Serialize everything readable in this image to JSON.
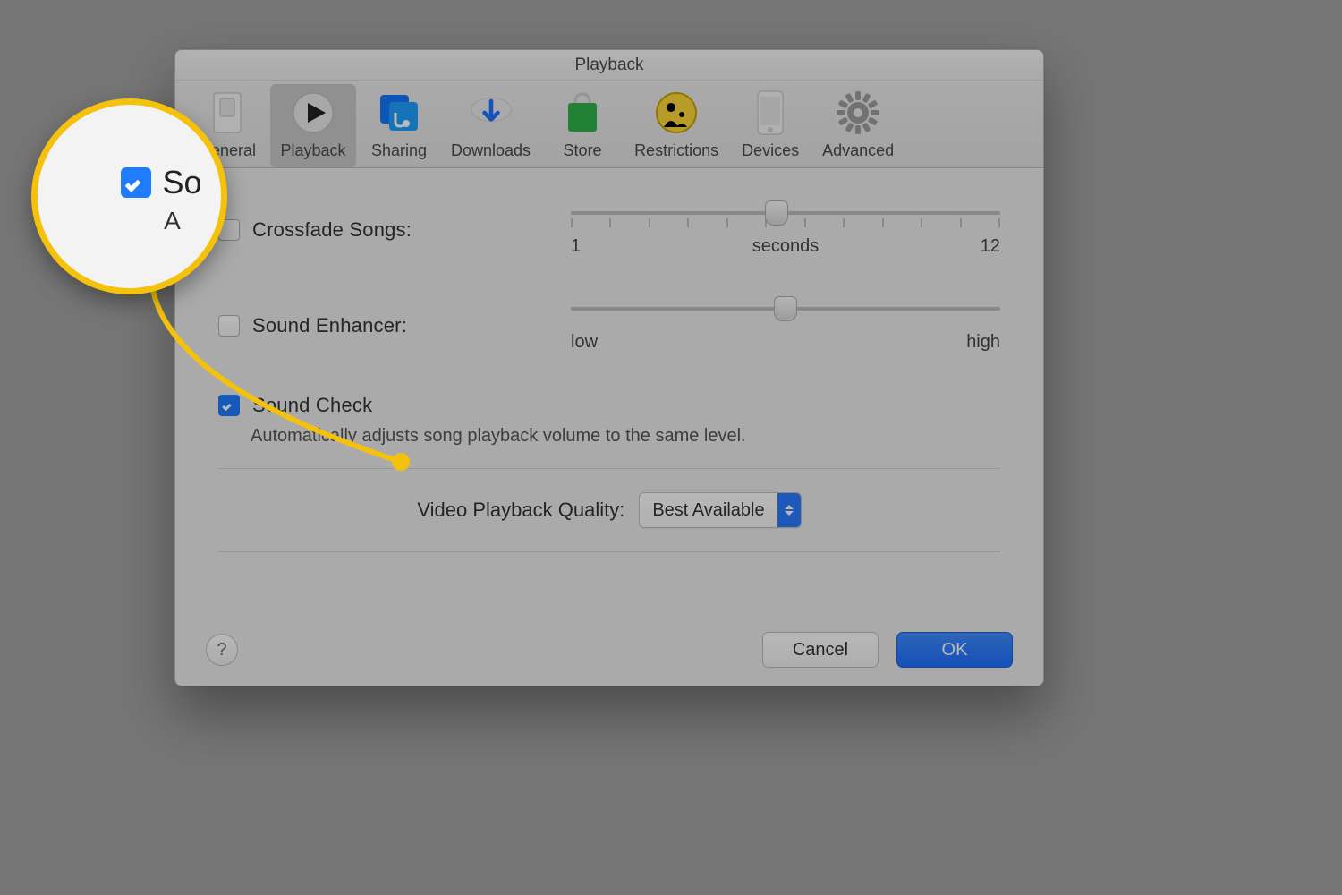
{
  "window": {
    "title": "Playback"
  },
  "toolbar": {
    "items": [
      {
        "label": "General"
      },
      {
        "label": "Playback"
      },
      {
        "label": "Sharing"
      },
      {
        "label": "Downloads"
      },
      {
        "label": "Store"
      },
      {
        "label": "Restrictions"
      },
      {
        "label": "Devices"
      },
      {
        "label": "Advanced"
      }
    ],
    "selected_index": 1
  },
  "options": {
    "crossfade": {
      "label": "Crossfade Songs:",
      "checked": false,
      "slider": {
        "min_label": "1",
        "mid_label": "seconds",
        "max_label": "12",
        "position_pct": 48,
        "ticks": 12
      }
    },
    "enhancer": {
      "label": "Sound Enhancer:",
      "checked": false,
      "slider": {
        "min_label": "low",
        "max_label": "high",
        "position_pct": 50
      }
    },
    "sound_check": {
      "label": "Sound Check",
      "checked": true,
      "description": "Automatically adjusts song playback volume to the same level."
    }
  },
  "video_quality": {
    "label": "Video Playback Quality:",
    "value": "Best Available"
  },
  "buttons": {
    "cancel": "Cancel",
    "ok": "OK",
    "help": "?"
  },
  "callout": {
    "line1": "So",
    "line2": "A"
  }
}
